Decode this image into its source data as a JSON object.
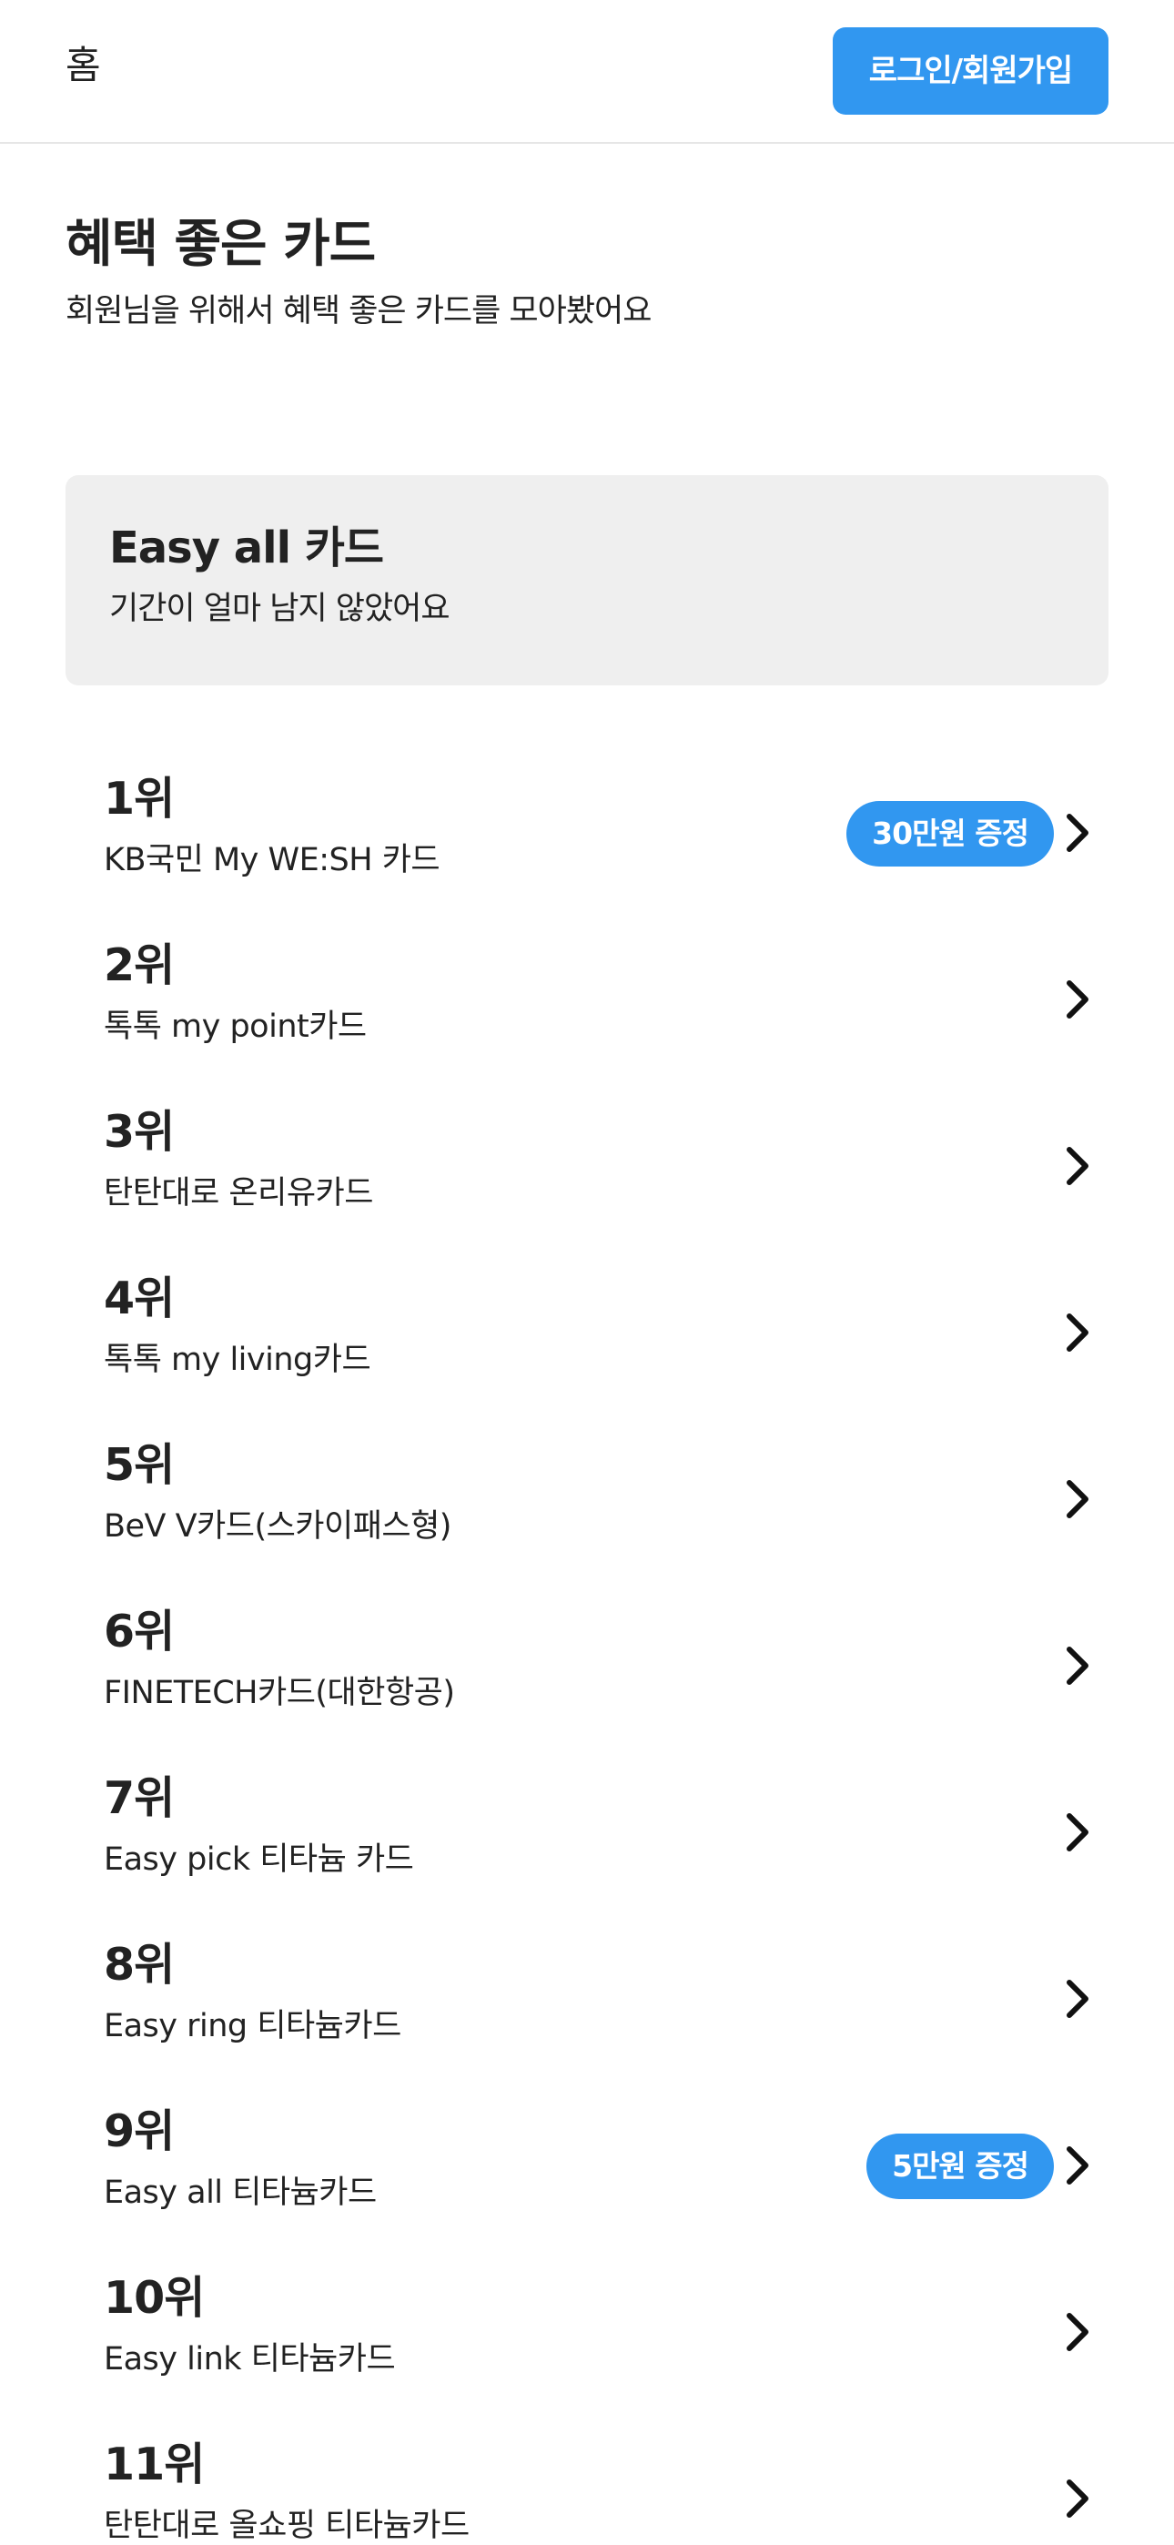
{
  "header": {
    "title": "홈",
    "login_label": "로그인/회원가입"
  },
  "main": {
    "title": "혜택 좋은 카드",
    "subtitle": "회원님을 위해서 혜택 좋은 카드를 모아봤어요"
  },
  "promo": {
    "title": "Easy all 카드",
    "subtitle": "기간이 얼마 남지 않았어요"
  },
  "colors": {
    "accent": "#3197f0",
    "promo_bg": "#efefef",
    "text": "#222222"
  },
  "ranking": [
    {
      "rank": "1위",
      "name": "KB국민 My WE:SH 카드",
      "badge": "30만원 증정"
    },
    {
      "rank": "2위",
      "name": "톡톡 my point카드"
    },
    {
      "rank": "3위",
      "name": "탄탄대로 온리유카드"
    },
    {
      "rank": "4위",
      "name": "톡톡 my living카드"
    },
    {
      "rank": "5위",
      "name": "BeV V카드(스카이패스형)"
    },
    {
      "rank": "6위",
      "name": "FINETECH카드(대한항공)"
    },
    {
      "rank": "7위",
      "name": "Easy pick 티타늄 카드"
    },
    {
      "rank": "8위",
      "name": "Easy ring 티타늄카드"
    },
    {
      "rank": "9위",
      "name": "Easy all 티타늄카드",
      "badge": "5만원 증정"
    },
    {
      "rank": "10위",
      "name": "Easy link 티타늄카드"
    },
    {
      "rank": "11위",
      "name": "탄탄대로 올쇼핑 티타늄카드"
    }
  ],
  "icons": {
    "row_arrow": "chevron-right-icon"
  }
}
